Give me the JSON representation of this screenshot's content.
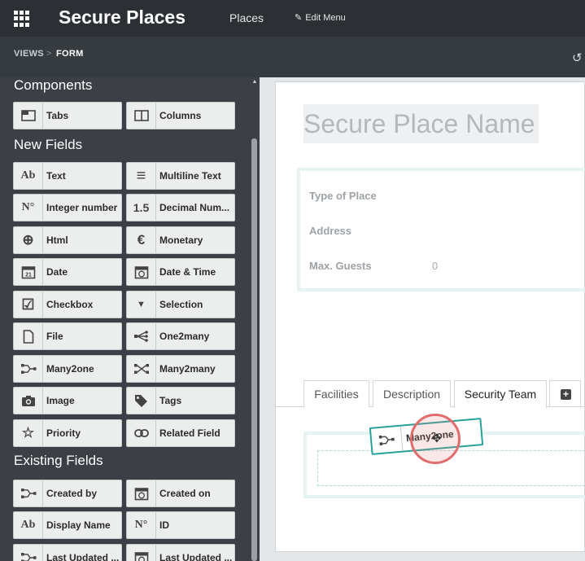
{
  "topbar": {
    "app_title": "Secure Places",
    "menu_places": "Places",
    "edit_menu": "Edit Menu"
  },
  "breadcrumb": {
    "views": "VIEWS",
    "sep": ">",
    "form": "FORM"
  },
  "sidebar": {
    "components_heading": "Components",
    "components": [
      {
        "label": "Tabs",
        "icon": "tabs-icon"
      },
      {
        "label": "Columns",
        "icon": "columns-icon"
      }
    ],
    "new_fields_heading": "New Fields",
    "new_fields": [
      {
        "label": "Text",
        "icon": "text-icon",
        "glyph": "Ab"
      },
      {
        "label": "Multiline Text",
        "icon": "multiline-text-icon",
        "glyph": "≡"
      },
      {
        "label": "Integer number",
        "icon": "integer-icon",
        "glyph": "N°"
      },
      {
        "label": "Decimal Num...",
        "icon": "decimal-icon",
        "glyph": "1.5"
      },
      {
        "label": "Html",
        "icon": "globe-icon",
        "glyph": "⊕"
      },
      {
        "label": "Monetary",
        "icon": "euro-icon",
        "glyph": "€"
      },
      {
        "label": "Date",
        "icon": "calendar-icon",
        "glyph": "21"
      },
      {
        "label": "Date & Time",
        "icon": "calendar-clock-icon",
        "glyph": "◷"
      },
      {
        "label": "Checkbox",
        "icon": "checkbox-icon",
        "glyph": "☑"
      },
      {
        "label": "Selection",
        "icon": "caret-down-icon",
        "glyph": "▼"
      },
      {
        "label": "File",
        "icon": "file-icon",
        "glyph": "🗋"
      },
      {
        "label": "One2many",
        "icon": "one2many-icon",
        "glyph": "⋘"
      },
      {
        "label": "Many2one",
        "icon": "many2one-icon",
        "glyph": "⋗"
      },
      {
        "label": "Many2many",
        "icon": "many2many-icon",
        "glyph": "⋈"
      },
      {
        "label": "Image",
        "icon": "camera-icon",
        "glyph": "◙"
      },
      {
        "label": "Tags",
        "icon": "tag-icon",
        "glyph": "◆"
      },
      {
        "label": "Priority",
        "icon": "star-icon",
        "glyph": "☆"
      },
      {
        "label": "Related Field",
        "icon": "link-icon",
        "glyph": "⊂⊃"
      }
    ],
    "existing_fields_heading": "Existing Fields",
    "existing_fields": [
      {
        "label": "Created by",
        "icon": "many2one-icon",
        "glyph": "⋗"
      },
      {
        "label": "Created on",
        "icon": "calendar-clock-icon",
        "glyph": "◷"
      },
      {
        "label": "Display Name",
        "icon": "text-icon",
        "glyph": "Ab"
      },
      {
        "label": "ID",
        "icon": "integer-icon",
        "glyph": "N°"
      },
      {
        "label": "Last Updated ...",
        "icon": "many2one-icon",
        "glyph": "⋗"
      },
      {
        "label": "Last Updated ...",
        "icon": "calendar-clock-icon",
        "glyph": "◷"
      }
    ]
  },
  "form": {
    "name_placeholder": "Secure Place Name",
    "fields": [
      {
        "label": "Type of Place",
        "value": ""
      },
      {
        "label": "Address",
        "value": ""
      },
      {
        "label": "Max. Guests",
        "value": "0"
      }
    ],
    "tabs": [
      {
        "label": "Facilities"
      },
      {
        "label": "Description"
      },
      {
        "label": "Security Team"
      }
    ]
  },
  "drag": {
    "label": "Many2one"
  }
}
